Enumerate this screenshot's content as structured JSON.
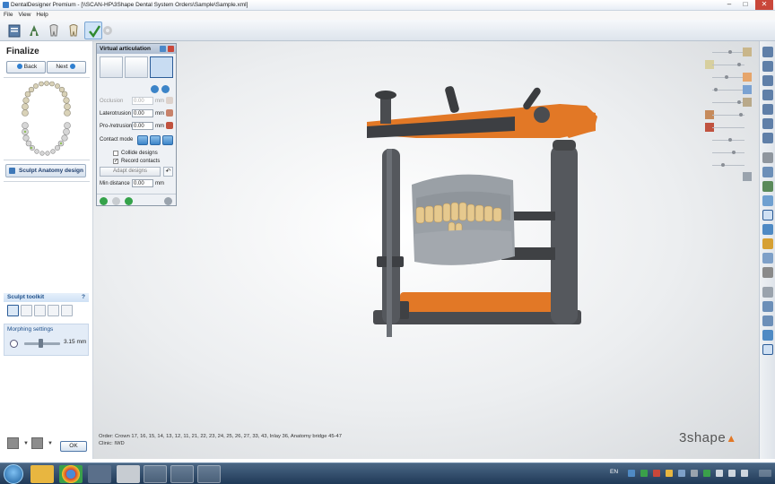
{
  "window": {
    "title": "DentalDesigner Premium - [\\\\SCAN-HP\\3Shape Dental System Orders\\Sample\\Sample.xml]",
    "min": "–",
    "max": "□",
    "close": "✕"
  },
  "menu": {
    "items": [
      "File",
      "View",
      "Help"
    ]
  },
  "toolbar": {
    "icons": [
      "order-icon",
      "scan-icon",
      "prepare-icon",
      "design-icon",
      "finalize-icon",
      "settings-icon"
    ]
  },
  "left": {
    "step_title": "Finalize",
    "back_label": "Back",
    "next_label": "Next",
    "sculpt_anatomy_label": "Sculpt Anatomy design",
    "sculpt_toolkit_title": "Sculpt toolkit",
    "help_label": "?",
    "morphing_title": "Morphing settings",
    "morph_value": "3.15 mm",
    "morph_level": 0.45,
    "ok_label": "OK"
  },
  "articulation": {
    "title": "Virtual articulation",
    "occlusion_label": "Occlusion",
    "occlusion_value": "0.00",
    "laterotrusion_label": "Laterotrusion",
    "laterotrusion_value": "0.00",
    "protrusion_label": "Pro-/retrusion",
    "protrusion_value": "0.00",
    "unit": "mm",
    "contact_mode_label": "Contact mode",
    "collide_label": "Collide designs",
    "collide_checked": false,
    "record_label": "Record contacts",
    "record_checked": true,
    "check_mark": "✓",
    "adapt_label": "Adapt designs",
    "undo_symbol": "↶",
    "min_distance_label": "Min distance",
    "min_distance_value": "0.00"
  },
  "info": {
    "order_line": "Order:  Crown 17, 16, 15, 14, 13, 12, 11, 21, 22, 23, 24, 25, 26, 27, 33, 43, Inlay 36, Anatomy bridge 45-47",
    "clinic_line": "Clinic:   IWD"
  },
  "brand": {
    "text": "3shape",
    "mark": "▲"
  },
  "taskbar": {
    "lang": "EN"
  },
  "colors": {
    "accent": "#e27826",
    "accent_blue": "#2b5c98",
    "articulator_gray": "#4a4c50"
  }
}
